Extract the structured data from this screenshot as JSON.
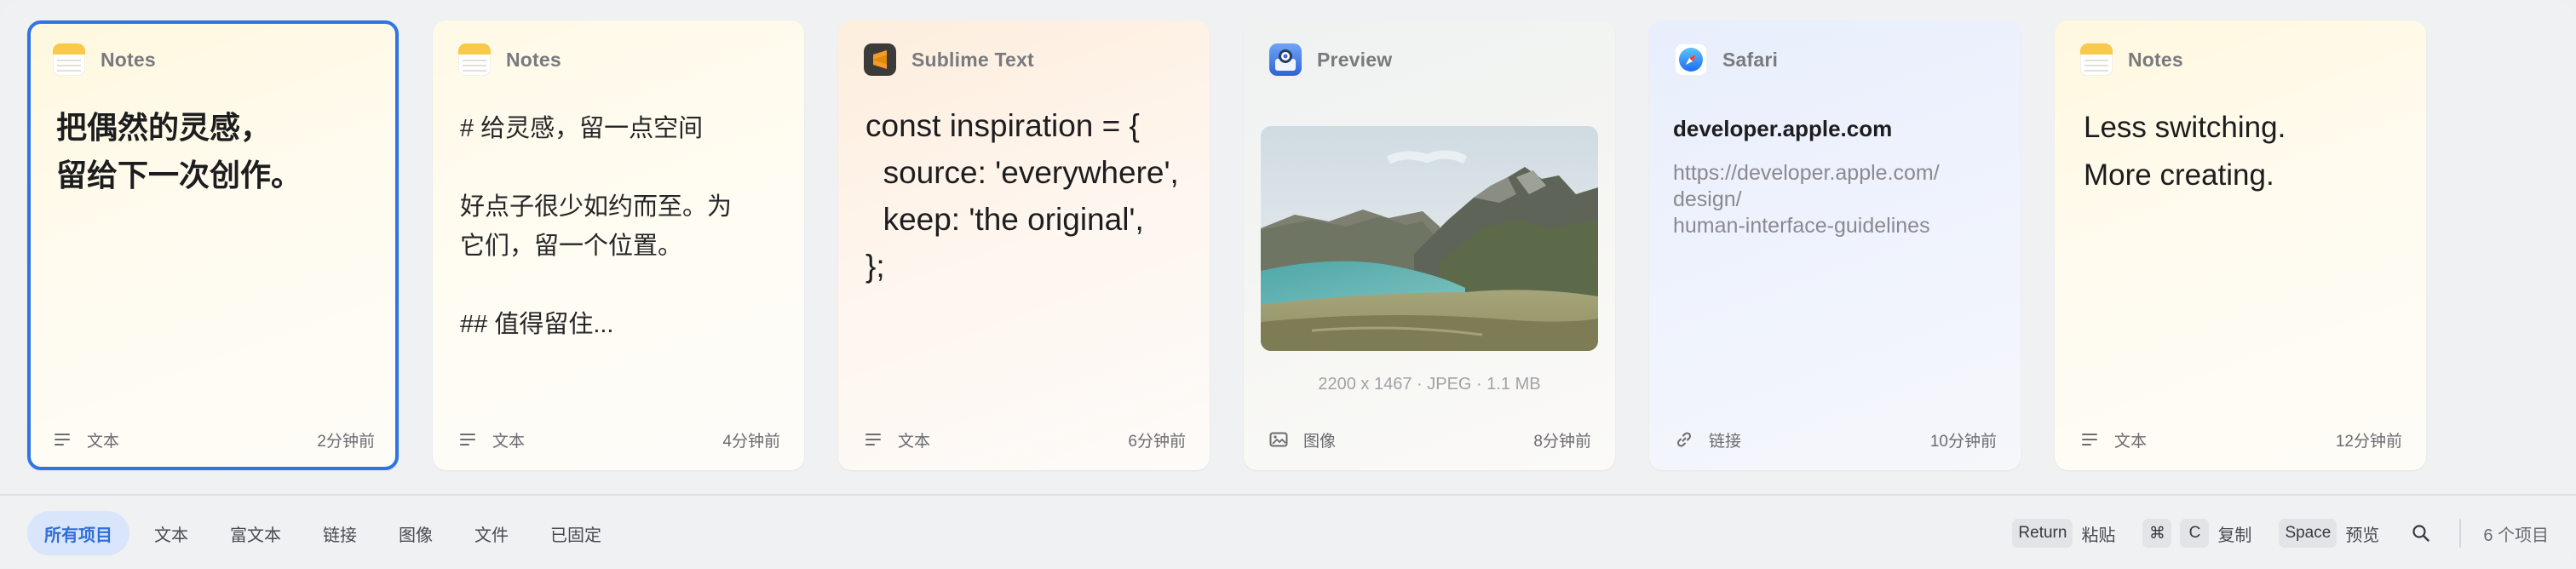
{
  "cards": [
    {
      "app": "Notes",
      "app_icon": "notes-icon",
      "content": "把偶然的灵感，\n留给下一次创作。",
      "type_label": "文本",
      "type_icon": "text-lines-icon",
      "time": "2分钟前",
      "selected": true
    },
    {
      "app": "Notes",
      "app_icon": "notes-icon",
      "content": "# 给灵感，留一点空间\n\n好点子很少如约而至。为\n它们，留一个位置。\n\n## 值得留住...",
      "type_label": "文本",
      "type_icon": "text-lines-icon",
      "time": "4分钟前"
    },
    {
      "app": "Sublime Text",
      "app_icon": "sublime-text-icon",
      "content": "const inspiration = {\n  source: 'everywhere',\n  keep: 'the original',\n};",
      "type_label": "文本",
      "type_icon": "text-lines-icon",
      "time": "6分钟前"
    },
    {
      "app": "Preview",
      "app_icon": "preview-icon",
      "image_meta": "2200 x 1467 · JPEG · 1.1 MB",
      "type_label": "图像",
      "type_icon": "image-icon",
      "time": "8分钟前"
    },
    {
      "app": "Safari",
      "app_icon": "safari-compass-icon",
      "link_title": "developer.apple.com",
      "link_url": "https://developer.apple.com/\ndesign/\nhuman-interface-guidelines",
      "type_label": "链接",
      "type_icon": "link-icon",
      "time": "10分钟前"
    },
    {
      "app": "Notes",
      "app_icon": "notes-icon",
      "content": "Less switching.\nMore creating.",
      "type_label": "文本",
      "type_icon": "text-lines-icon",
      "time": "12分钟前"
    }
  ],
  "filters": [
    {
      "label": "所有项目",
      "active": true
    },
    {
      "label": "文本"
    },
    {
      "label": "富文本"
    },
    {
      "label": "链接"
    },
    {
      "label": "图像"
    },
    {
      "label": "文件"
    },
    {
      "label": "已固定"
    }
  ],
  "shortcuts": {
    "paste_key": "Return",
    "paste_label": "粘贴",
    "copy_key_mod": "⌘",
    "copy_key": "C",
    "copy_label": "复制",
    "preview_key": "Space",
    "preview_label": "预览"
  },
  "item_count": "6 个项目",
  "colors": {
    "accent": "#2f74e4",
    "active_filter_bg": "#d9e5fa"
  }
}
